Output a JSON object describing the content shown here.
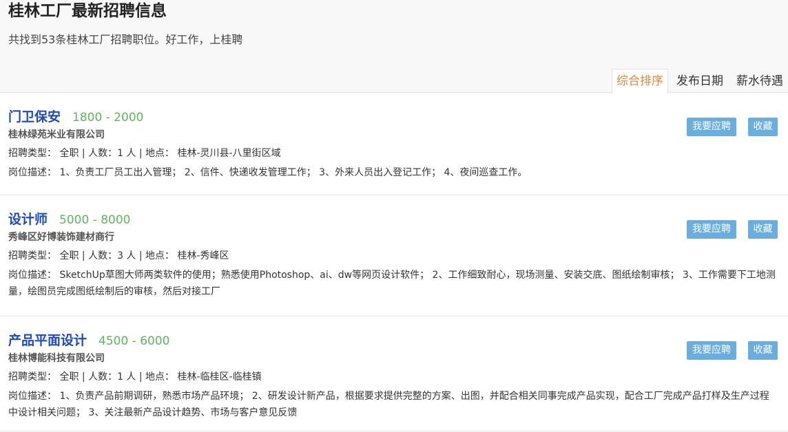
{
  "header": {
    "title": "桂林工厂最新招聘信息",
    "subtitle": "共找到53条桂林工厂招聘职位。好工作，上桂聘"
  },
  "sort_tabs": [
    {
      "label": "综合排序",
      "active": true
    },
    {
      "label": "发布日期",
      "active": false
    },
    {
      "label": "薪水待遇",
      "active": false
    }
  ],
  "buttons": {
    "apply_label": "我要应聘",
    "favorite_label": "收藏"
  },
  "jobs": [
    {
      "title": "门卫保安",
      "salary": "1800 - 2000",
      "company": "桂林绿苑米业有限公司",
      "meta": "招聘类型： 全职 | 人数：1 人 | 地点： 桂林-灵川县-八里街区域",
      "description": "岗位描述： 1、负责工厂员工出入管理； 2、信件、快递收发管理工作； 3、外来人员出入登记工作； 4、夜间巡查工作。"
    },
    {
      "title": "设计师",
      "salary": "5000 - 8000",
      "company": "秀峰区好博装饰建材商行",
      "meta": "招聘类型： 全职 | 人数：3 人 | 地点： 桂林-秀峰区",
      "description": "岗位描述： SketchUp草图大师两类软件的使用；熟悉使用Photoshop、ai、dw等网页设计软件； 2、工作细致耐心，现场测量、安装交底、图纸绘制审核； 3、工作需要下工地测量，绘图员完成图纸绘制后的审核，然后对接工厂"
    },
    {
      "title": "产品平面设计",
      "salary": "4500 - 6000",
      "company": "桂林博能科技有限公司",
      "meta": "招聘类型： 全职 | 人数：1 人 | 地点： 桂林-临桂区-临桂镇",
      "description": "岗位描述： 1、负责产品前期调研，熟悉市场产品环境； 2、研发设计新产品，根据要求提供完整的方案、出图，并配合相关同事完成产品实现，配合工厂完成产品打样及生产过程中设计相关问题； 3、关注最新产品设计趋势、市场与客户意见反馈"
    }
  ],
  "colors": {
    "title_blue": "#1c49c7",
    "salary_green": "#5cb85c",
    "active_tab_orange": "#e8873a",
    "button_blue": "#6aaee1"
  }
}
